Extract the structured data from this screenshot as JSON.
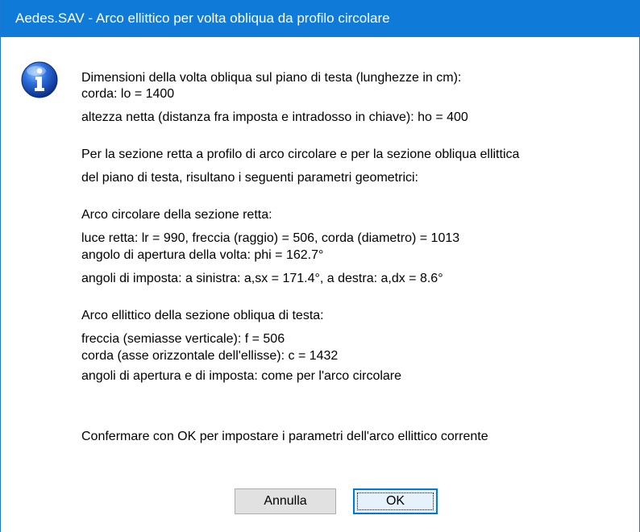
{
  "window": {
    "title": "Aedes.SAV - Arco ellittico per volta obliqua da profilo circolare"
  },
  "icon": {
    "name": "info-icon",
    "color": "#1c58c4"
  },
  "message": {
    "lines": [
      "Dimensioni della volta obliqua sul piano di testa (lunghezze in cm):",
      "corda: lo = 1400",
      "altezza netta (distanza fra imposta e intradosso in chiave): ho = 400",
      "Per la sezione retta a profilo di arco circolare e per la sezione obliqua ellittica",
      "del piano di testa, risultano i seguenti parametri geometrici:",
      "Arco circolare della sezione retta:",
      "luce retta: lr = 990, freccia (raggio) = 506, corda (diametro) = 1013",
      "angolo di apertura della volta: phi = 162.7°",
      "angoli di imposta: a sinistra: a,sx = 171.4°, a destra: a,dx = 8.6°",
      "Arco ellittico della sezione obliqua di testa:",
      "freccia (semiasse verticale): f = 506",
      "corda (asse orizzontale dell'ellisse): c = 1432",
      "angoli di apertura e di imposta: come per l'arco circolare",
      "Confermare con OK per impostare i parametri dell'arco ellittico corrente"
    ]
  },
  "buttons": {
    "cancel_label": "Annulla",
    "ok_label": "OK"
  },
  "colors": {
    "titlebar": "#0f7ad8",
    "title_text": "#ffffff",
    "default_button_border": "#0078d7"
  }
}
